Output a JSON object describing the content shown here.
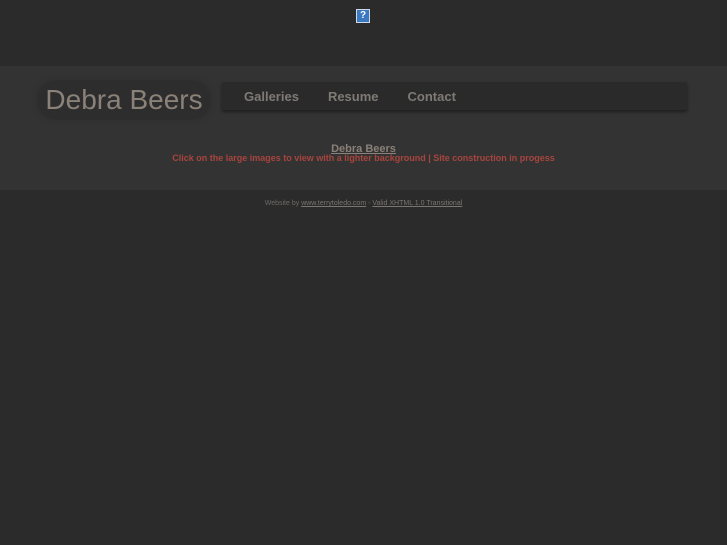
{
  "top": {
    "broken_image_glyph": "?"
  },
  "header": {
    "logo_text": "Debra Beers",
    "nav": [
      {
        "label": "Galleries"
      },
      {
        "label": "Resume"
      },
      {
        "label": "Contact"
      }
    ]
  },
  "main": {
    "title_link": "Debra Beers",
    "notice": "Click on the large images to view with a lighter background | Site construction in progess"
  },
  "footer": {
    "prefix": "Website by ",
    "designer_link": "www.terrytoledo.com",
    "separator": " - ",
    "validator_link": "Valid XHTML 1.0 Transitional"
  },
  "colors": {
    "background": "#2b2b2b",
    "band": "#333333",
    "notice": "#a8453e",
    "nav_text": "#7e7a75"
  }
}
